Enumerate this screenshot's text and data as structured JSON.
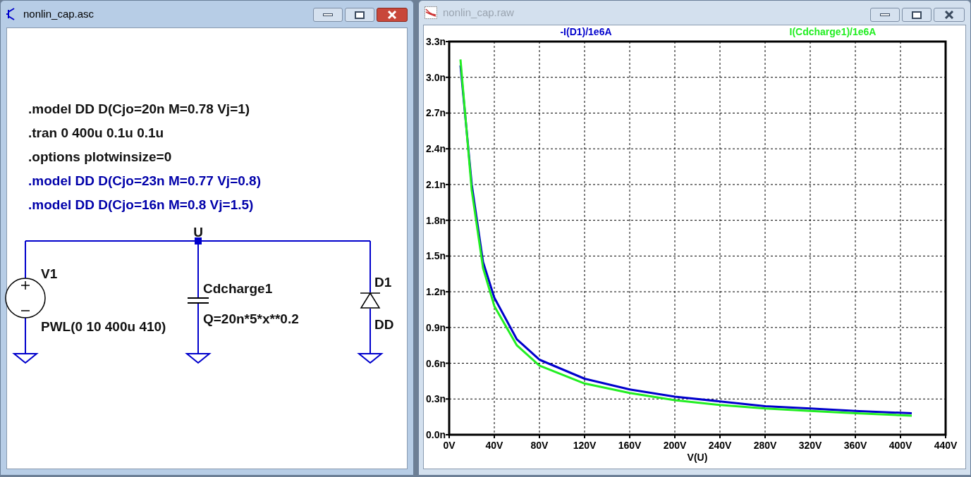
{
  "windows": [
    {
      "title": "nonlin_cap.asc",
      "active": true,
      "kind": "schematic"
    },
    {
      "title": "nonlin_cap.raw",
      "active": false,
      "kind": "waveform"
    }
  ],
  "schematic": {
    "directives": [
      {
        "text": ".model DD D(Cjo=20n M=0.78 Vj=1)",
        "kind": "directive"
      },
      {
        "text": ".tran 0 400u 0.1u 0.1u",
        "kind": "directive"
      },
      {
        "text": ".options plotwinsize=0",
        "kind": "directive"
      },
      {
        "text": ".model DD D(Cjo=23n M=0.77 Vj=0.8)",
        "kind": "comment"
      },
      {
        "text": ".model DD D(Cjo=16n M=0.8 Vj=1.5)",
        "kind": "comment"
      }
    ],
    "net_label": "U",
    "components": [
      {
        "kind": "voltage_source",
        "name": "V1",
        "value": "PWL(0 10 400u 410)"
      },
      {
        "kind": "capacitor",
        "name": "Cdcharge1",
        "value": "Q=20n*5*x**0.2"
      },
      {
        "kind": "diode",
        "name": "D1",
        "value": "DD"
      }
    ]
  },
  "plot": {
    "chart_data": {
      "type": "line",
      "grid": true,
      "xlabel": "V(U)",
      "x": [
        10,
        20,
        30,
        40,
        60,
        80,
        120,
        160,
        200,
        240,
        280,
        320,
        360,
        410
      ],
      "series": [
        {
          "name": "-I(D1)/1e6A",
          "color": "#0000cc",
          "values": [
            3.1,
            2.1,
            1.45,
            1.15,
            0.8,
            0.63,
            0.47,
            0.38,
            0.32,
            0.28,
            0.24,
            0.22,
            0.2,
            0.18
          ]
        },
        {
          "name": "I(Cdcharge1)/1e6A",
          "color": "#22ee22",
          "values": [
            3.15,
            2.05,
            1.4,
            1.08,
            0.75,
            0.58,
            0.43,
            0.35,
            0.29,
            0.25,
            0.22,
            0.2,
            0.18,
            0.16
          ]
        }
      ],
      "xlim": [
        0,
        440
      ],
      "ylim": [
        0,
        3.3
      ],
      "xticks": [
        {
          "value": 0,
          "label": "0V"
        },
        {
          "value": 40,
          "label": "40V"
        },
        {
          "value": 80,
          "label": "80V"
        },
        {
          "value": 120,
          "label": "120V"
        },
        {
          "value": 160,
          "label": "160V"
        },
        {
          "value": 200,
          "label": "200V"
        },
        {
          "value": 240,
          "label": "240V"
        },
        {
          "value": 280,
          "label": "280V"
        },
        {
          "value": 320,
          "label": "320V"
        },
        {
          "value": 360,
          "label": "360V"
        },
        {
          "value": 400,
          "label": "400V"
        },
        {
          "value": 440,
          "label": "440V"
        }
      ],
      "yticks": [
        {
          "value": 0,
          "label": "0.0n"
        },
        {
          "value": 0.3,
          "label": "0.3n"
        },
        {
          "value": 0.6,
          "label": "0.6n"
        },
        {
          "value": 0.9,
          "label": "0.9n"
        },
        {
          "value": 1.2,
          "label": "1.2n"
        },
        {
          "value": 1.5,
          "label": "1.5n"
        },
        {
          "value": 1.8,
          "label": "1.8n"
        },
        {
          "value": 2.1,
          "label": "2.1n"
        },
        {
          "value": 2.4,
          "label": "2.4n"
        },
        {
          "value": 2.7,
          "label": "2.7n"
        },
        {
          "value": 3.0,
          "label": "3.0n"
        },
        {
          "value": 3.3,
          "label": "3.3n"
        }
      ]
    }
  }
}
